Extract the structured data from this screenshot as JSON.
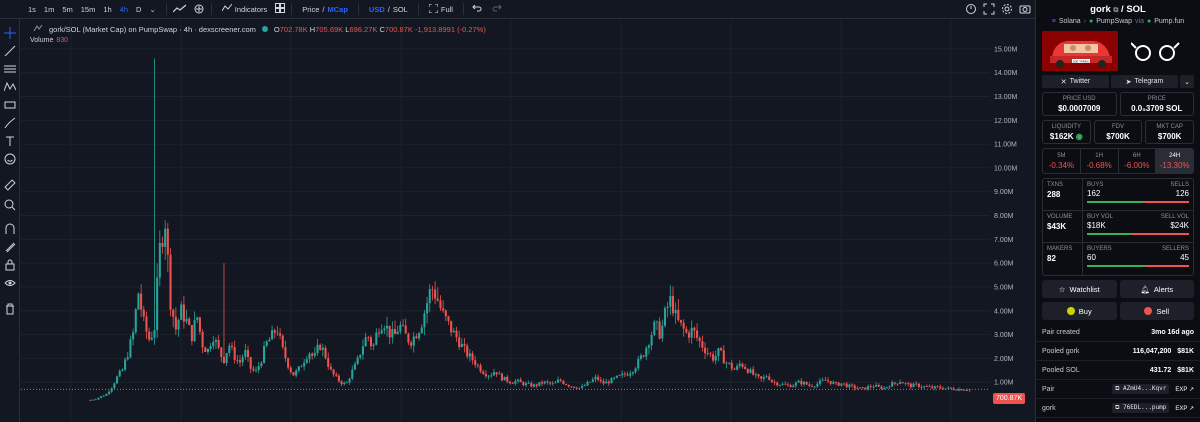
{
  "toolbar": {
    "timeframes": [
      "1s",
      "1m",
      "5m",
      "15m",
      "1h",
      "4h",
      "D"
    ],
    "active_timeframe": "4h",
    "indicators_label": "Indicators",
    "price_label": "Price",
    "mcap_label": "MCap",
    "usd_label": "USD",
    "sol_label": "SOL",
    "full_label": "Full",
    "slash": "/"
  },
  "legend": {
    "title": "gork/SOL (Market Cap) on PumpSwap · 4h · dexscreener.com",
    "o_label": "O",
    "o_val": "702.78K",
    "h_label": "H",
    "h_val": "705.69K",
    "l_label": "L",
    "l_val": "696.27K",
    "c_label": "C",
    "c_val": "700.87K",
    "change": "-1,913.8991 (-0.27%)",
    "volume_label": "Volume",
    "volume_val": "830"
  },
  "price_tag": "700.87K",
  "colors": {
    "up": "#26a69a",
    "down": "#ef5350",
    "accent": "#2962ff",
    "bg": "#131722"
  },
  "chart_data": {
    "type": "candlestick",
    "ylim": [
      0,
      15500000
    ],
    "y_ticks": [
      "15.00M",
      "14.00M",
      "13.00M",
      "12.00M",
      "11.00M",
      "10.00M",
      "9.00M",
      "8.00M",
      "7.00M",
      "6.00M",
      "5.00M",
      "4.00M",
      "3.00M",
      "2.00M",
      "1.00M"
    ],
    "tick_values": [
      15000000,
      14000000,
      13000000,
      12000000,
      11000000,
      10000000,
      9000000,
      8000000,
      7000000,
      6000000,
      5000000,
      4000000,
      3000000,
      2000000,
      1000000
    ],
    "close_path": [
      0.25,
      0.3,
      0.4,
      0.5,
      0.8,
      1.2,
      1.5,
      2.2,
      3.0,
      4.8,
      3.5,
      2.8,
      3.2,
      6.5,
      8.0,
      4.5,
      3.2,
      4.0,
      3.6,
      2.9,
      3.8,
      2.6,
      2.3,
      3.0,
      2.4,
      1.9,
      2.6,
      2.1,
      1.8,
      2.3,
      1.6,
      1.4,
      1.9,
      2.6,
      2.9,
      3.3,
      2.4,
      1.8,
      1.3,
      1.5,
      1.9,
      2.3,
      2.0,
      2.6,
      2.2,
      1.5,
      1.2,
      1.0,
      0.9,
      1.4,
      1.8,
      2.5,
      3.0,
      2.4,
      3.3,
      3.6,
      3.1,
      2.9,
      3.4,
      3.0,
      2.7,
      3.0,
      3.4,
      4.2,
      5.0,
      4.6,
      3.9,
      3.5,
      3.1,
      2.8,
      2.4,
      2.1,
      1.9,
      1.6,
      1.4,
      1.3,
      1.5,
      1.2,
      1.1,
      1.0,
      1.05,
      0.95,
      0.9,
      0.85,
      0.9,
      1.0,
      0.95,
      0.9,
      1.1,
      0.95,
      0.85,
      0.8,
      0.75,
      0.9,
      1.05,
      1.2,
      0.95,
      1.0,
      1.1,
      1.2,
      1.3,
      1.4,
      1.6,
      1.9,
      2.3,
      2.9,
      3.4,
      3.0,
      4.0,
      4.5,
      3.6,
      3.3,
      3.0,
      3.2,
      2.8,
      2.5,
      2.2,
      2.0,
      2.3,
      1.9,
      1.7,
      1.5,
      1.8,
      1.6,
      1.4,
      1.2,
      1.1,
      1.3,
      1.0,
      0.95,
      0.9,
      0.85,
      0.9,
      1.0,
      0.95,
      0.85,
      0.9,
      1.0,
      1.1,
      1.0,
      0.9,
      0.95,
      0.85,
      0.8,
      0.75,
      0.72,
      0.8,
      0.85,
      0.78,
      0.75,
      0.9,
      0.95,
      1.05,
      0.92,
      0.85,
      0.88,
      0.82,
      0.8,
      0.76,
      0.78,
      0.75,
      0.73,
      0.72,
      0.7,
      0.71,
      0.7
    ],
    "spikes": [
      [
        12,
        14.6
      ],
      [
        25,
        6.0
      ]
    ]
  },
  "panel": {
    "token": "gork",
    "slash": "/",
    "quote": "SOL",
    "chain": "Solana",
    "dex": "PumpSwap",
    "via": "via",
    "launchpad": "Pump.fun",
    "car_plate": "JOE TARDO",
    "twitter": "Twitter",
    "telegram": "Telegram",
    "price_usd_k": "PRICE USD",
    "price_usd_v": "$0.0007009",
    "price_k": "PRICE",
    "price_v": "0.0₅3709 SOL",
    "liq_k": "LIQUIDITY",
    "liq_v": "$162K",
    "fdv_k": "FDV",
    "fdv_v": "$700K",
    "mcap_k": "MKT CAP",
    "mcap_v": "$700K",
    "tabs": [
      {
        "k": "5M",
        "v": "-0.34%"
      },
      {
        "k": "1H",
        "v": "-0.68%"
      },
      {
        "k": "6H",
        "v": "-6.00%"
      },
      {
        "k": "24H",
        "v": "-13.30%"
      }
    ],
    "txns_k": "TXNS",
    "txns_v": "288",
    "buys_k": "BUYS",
    "buys_v": "162",
    "sells_k": "SELLS",
    "sells_v": "126",
    "buys_frac": 0.5625,
    "volume_k": "VOLUME",
    "volume_v": "$43K",
    "buyvol_k": "BUY VOL",
    "buyvol_v": "$18K",
    "sellvol_k": "SELL VOL",
    "sellvol_v": "$24K",
    "buyvol_frac": 0.43,
    "makers_k": "MAKERS",
    "makers_v": "82",
    "buyers_k": "BUYERS",
    "buyers_v": "60",
    "sellers_k": "SELLERS",
    "sellers_v": "45",
    "buyers_frac": 0.57,
    "watchlist": "Watchlist",
    "alerts": "Alerts",
    "buy": "Buy",
    "sell": "Sell",
    "pair_created_k": "Pair created",
    "pair_created_v": "3mo 16d ago",
    "pooled_gork_k": "Pooled gork",
    "pooled_gork_v": "116,047,200",
    "pooled_gork_usd": "$81K",
    "pooled_sol_k": "Pooled SOL",
    "pooled_sol_v": "431.72",
    "pooled_sol_usd": "$81K",
    "pair_k": "Pair",
    "pair_addr": "AZmU4...Kqvr",
    "exp": "EXP",
    "gork_k": "gork",
    "gork_addr": "76EDL...pump"
  }
}
